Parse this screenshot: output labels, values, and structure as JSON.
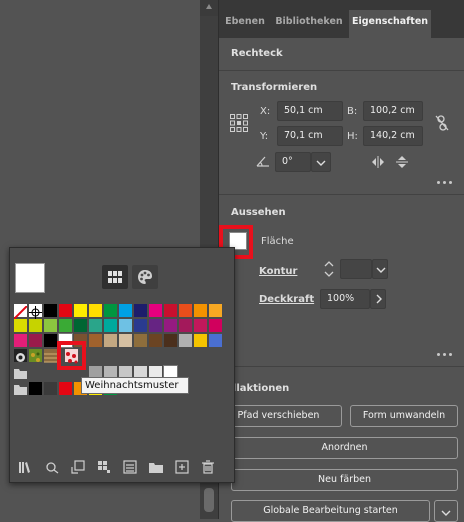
{
  "tabs": [
    {
      "label": "Ebenen"
    },
    {
      "label": "Bibliotheken"
    },
    {
      "label": "Eigenschaften"
    }
  ],
  "object_type": "Rechteck",
  "transform": {
    "title": "Transformieren",
    "x_label": "X:",
    "x_value": "50,1 cm",
    "y_label": "Y:",
    "y_value": "70,1 cm",
    "b_label": "B:",
    "b_value": "100,2 cm",
    "h_label": "H:",
    "h_value": "140,2 cm",
    "angle_value": "0°"
  },
  "appearance": {
    "title": "Aussehen",
    "fill_label": "Fläche",
    "stroke_label": "Kontur",
    "opacity_label": "Deckkraft",
    "opacity_value": "100%"
  },
  "quick_actions": {
    "title": "nellaktionen",
    "offset_path_label": "Pfad verschieben",
    "convert_shape_label": "Form umwandeln",
    "arrange_label": "Anordnen",
    "recolor_label": "Neu färben",
    "global_edit_label": "Globale Bearbeitung starten"
  },
  "swatch_tooltip": "Weihnachtsmuster",
  "colors": {
    "highlight": "#e8101c",
    "panel_bg": "#535353",
    "tab_bar_bg": "#383838",
    "swatch_rows": [
      [
        "#ffffff",
        "#ffffff",
        "#000000",
        "#e30613",
        "#ffed00",
        "#ffdd00",
        "#009640",
        "#00a0e3",
        "#1d1d6b",
        "#e6007e",
        "#c8102e",
        "#e94e1b",
        "#f39200",
        "#f7a823"
      ],
      [
        "#dadb00",
        "#c6d300",
        "#8cc63f",
        "#3aaa35",
        "#006633",
        "#2aa58a",
        "#00a99d",
        "#6ec1e4",
        "#2a3b8f",
        "#662483",
        "#951b81",
        "#a3195b",
        "#c2185b",
        "#d1005d"
      ],
      [
        "#e41e78",
        "#9a1b4b",
        "#000000",
        "#ffffff",
        "#7a5230",
        "#a0622d",
        "#c4a882",
        "#d6c0a2",
        "#8e6e3c",
        "#6b4423",
        "#4b2f1c",
        "#b0b0b0",
        "#f5c400",
        "#4a6fd1"
      ]
    ],
    "gray_row": [
      "#a0a0a0",
      "#b5b5b5",
      "#c7c7c7",
      "#d8d8d8",
      "#ebebeb",
      "#ffffff"
    ],
    "last_row": [
      "#000000",
      "#3b3b3b",
      "#e30613",
      "#f39200",
      "#ffed00",
      "#009640"
    ]
  },
  "icons": {
    "transform_ref": "reference-point-icon",
    "link": "constrain-proportions-icon",
    "angle": "rotate-angle-icon",
    "flip_h": "flip-horizontal-icon",
    "flip_v": "flip-vertical-icon",
    "swatch_view": "swatch-grid-view-icon",
    "color_view": "color-palette-icon"
  }
}
